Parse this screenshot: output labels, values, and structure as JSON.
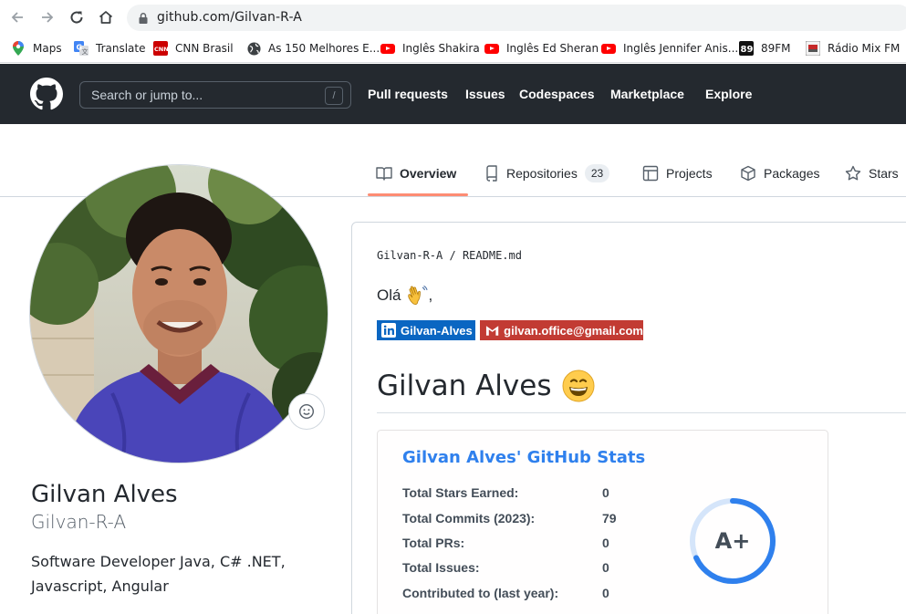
{
  "browser": {
    "url": "github.com/Gilvan-R-A",
    "bookmarks": [
      {
        "label": "Maps",
        "icon": "maps-pin-icon"
      },
      {
        "label": "Translate",
        "icon": "translate-icon"
      },
      {
        "label": "CNN Brasil",
        "icon": "cnn-icon"
      },
      {
        "label": "As 150 Melhores E...",
        "icon": "globe-icon"
      },
      {
        "label": "Inglês Shakira",
        "icon": "youtube-icon"
      },
      {
        "label": "Inglês Ed Sheran",
        "icon": "youtube-icon"
      },
      {
        "label": "Inglês Jennifer Anis...",
        "icon": "youtube-icon"
      },
      {
        "label": "89FM",
        "icon": "radio-89-icon"
      },
      {
        "label": "Rádio Mix FM",
        "icon": "radio-mix-icon"
      }
    ]
  },
  "github": {
    "search_placeholder": "Search or jump to...",
    "search_shortcut": "/",
    "nav": [
      "Pull requests",
      "Issues",
      "Codespaces",
      "Marketplace",
      "Explore"
    ]
  },
  "tabs": [
    {
      "label": "Overview",
      "icon": "book-icon",
      "active": true
    },
    {
      "label": "Repositories",
      "icon": "repo-icon",
      "count": "23"
    },
    {
      "label": "Projects",
      "icon": "table-icon"
    },
    {
      "label": "Packages",
      "icon": "package-icon"
    },
    {
      "label": "Stars",
      "icon": "star-icon"
    }
  ],
  "profile": {
    "name": "Gilvan Alves",
    "login": "Gilvan-R-A",
    "bio": "Software Developer Java, C# .NET, Javascript, Angular"
  },
  "readme": {
    "path_user": "Gilvan-R-A",
    "path_sep": "/",
    "path_file": "README.md",
    "greeting": "Olá",
    "greeting_punct": ",",
    "badges": [
      {
        "label": "Gilvan-Alves",
        "color": "#0a66c2",
        "icon": "linkedin-icon"
      },
      {
        "label": "gilvan.office@gmail.com",
        "color": "#c23b33",
        "icon": "gmail-icon"
      }
    ],
    "heading": "Gilvan Alves",
    "stats": {
      "title": "Gilvan Alves' GitHub Stats",
      "rows": [
        {
          "label": "Total Stars Earned:",
          "value": "0"
        },
        {
          "label": "Total Commits (2023):",
          "value": "79"
        },
        {
          "label": "Total PRs:",
          "value": "0"
        },
        {
          "label": "Total Issues:",
          "value": "0"
        },
        {
          "label": "Contributed to (last year):",
          "value": "0"
        }
      ],
      "rank": "A+",
      "rank_progress": 0.68,
      "title_color": "#2f80ed",
      "ring_color": "#2f80ed"
    }
  }
}
